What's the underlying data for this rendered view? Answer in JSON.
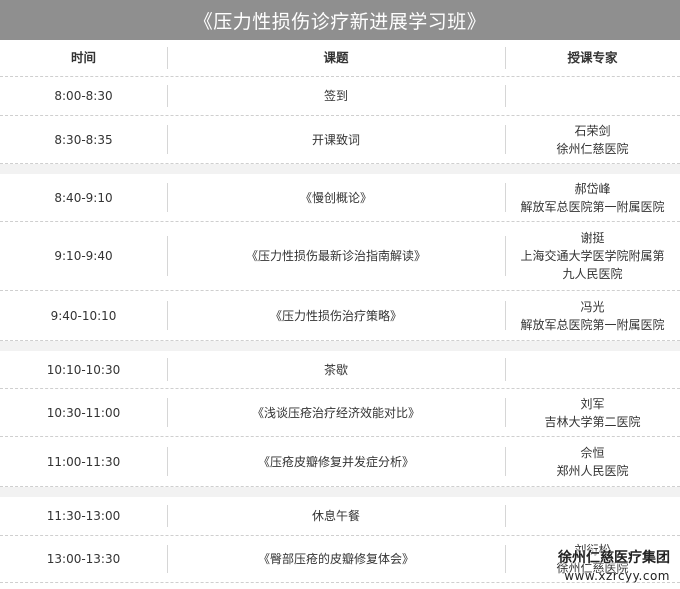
{
  "title": "《压力性损伤诊疗新进展学习班》",
  "headers": {
    "time": "时间",
    "topic": "课题",
    "speaker": "授课专家"
  },
  "rows": [
    {
      "time": "8:00-8:30",
      "topic": "签到",
      "speaker": []
    },
    {
      "time": "8:30-8:35",
      "topic": "开课致词",
      "speaker": [
        "石荣剑",
        "徐州仁慈医院"
      ]
    },
    {
      "time": "8:40-9:10",
      "topic": "《慢创概论》",
      "speaker": [
        "郝岱峰",
        "解放军总医院第一附属医院"
      ]
    },
    {
      "time": "9:10-9:40",
      "topic": "《压力性损伤最新诊治指南解读》",
      "speaker": [
        "谢挺",
        "上海交通大学医学院附属第",
        "九人民医院"
      ]
    },
    {
      "time": "9:40-10:10",
      "topic": "《压力性损伤治疗策略》",
      "speaker": [
        "冯光",
        "解放军总医院第一附属医院"
      ]
    },
    {
      "time": "10:10-10:30",
      "topic": "茶歇",
      "speaker": []
    },
    {
      "time": "10:30-11:00",
      "topic": "《浅谈压疮治疗经济效能对比》",
      "speaker": [
        "刘军",
        "吉林大学第二医院"
      ]
    },
    {
      "time": "11:00-11:30",
      "topic": "《压疮皮瓣修复并发症分析》",
      "speaker": [
        "佘恒",
        "郑州人民医院"
      ]
    },
    {
      "time": "11:30-13:00",
      "topic": "休息午餐",
      "speaker": []
    },
    {
      "time": "13:00-13:30",
      "topic": "《臀部压疮的皮瓣修复体会》",
      "speaker": [
        "刘衍松",
        "徐州仁慈医院"
      ]
    }
  ],
  "watermark": {
    "name": "徐州仁慈医疗集团",
    "url": "www.xzrcyy.com"
  }
}
